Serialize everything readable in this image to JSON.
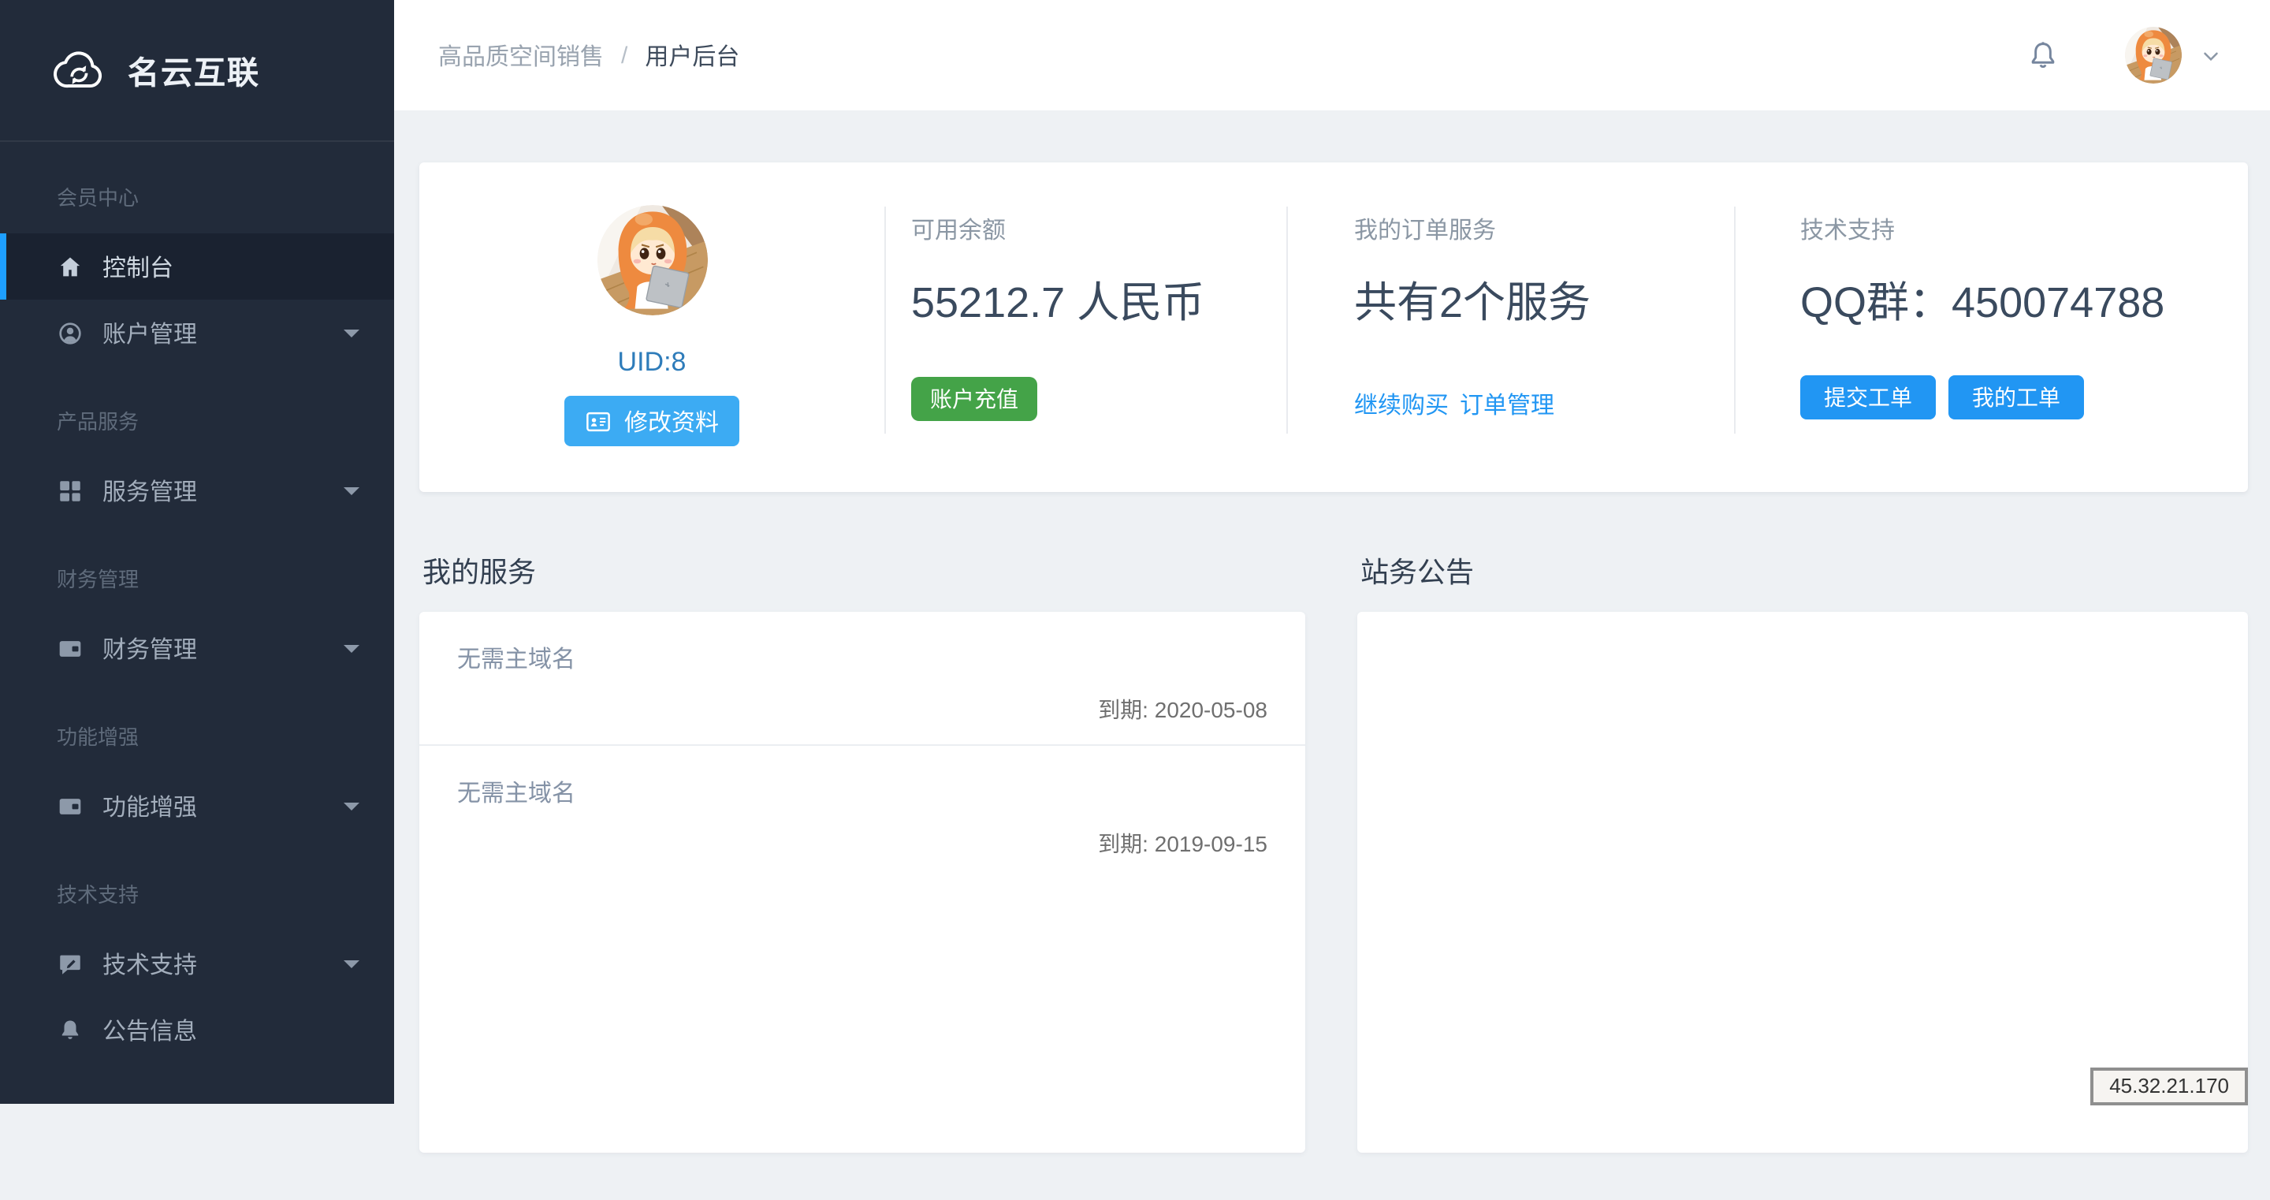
{
  "brand": {
    "title": "名云互联",
    "logo_icon": "cloud-sync-icon"
  },
  "breadcrumb": {
    "section": "高品质空间销售",
    "separator": "/",
    "page": "用户后台"
  },
  "topbar": {
    "icons": [
      "bell-icon",
      "user-avatar",
      "chevron-down-icon"
    ]
  },
  "sidebar": {
    "sections": [
      {
        "label": "会员中心",
        "items": [
          {
            "label": "控制台",
            "icon": "home-icon",
            "active": true,
            "caret": false
          },
          {
            "label": "账户管理",
            "icon": "user-circle-icon",
            "active": false,
            "caret": true
          }
        ]
      },
      {
        "label": "产品服务",
        "items": [
          {
            "label": "服务管理",
            "icon": "grid-icon",
            "active": false,
            "caret": true
          }
        ]
      },
      {
        "label": "财务管理",
        "items": [
          {
            "label": "财务管理",
            "icon": "wallet-icon",
            "active": false,
            "caret": true
          }
        ]
      },
      {
        "label": "功能增强",
        "items": [
          {
            "label": "功能增强",
            "icon": "wallet-icon",
            "active": false,
            "caret": true
          }
        ]
      },
      {
        "label": "技术支持",
        "items": [
          {
            "label": "技术支持",
            "icon": "comment-edit-icon",
            "active": false,
            "caret": true
          },
          {
            "label": "公告信息",
            "icon": "bell-icon",
            "active": false,
            "caret": false
          }
        ]
      }
    ]
  },
  "overview": {
    "account": {
      "uid": "UID:8",
      "edit_button": "修改资料",
      "edit_icon": "id-card-icon"
    },
    "balance": {
      "label": "可用余额",
      "value": "55212.7 人民币",
      "recharge_button": "账户充值"
    },
    "orders": {
      "label": "我的订单服务",
      "value": "共有2个服务",
      "link_continue": "继续购买",
      "link_manage": "订单管理"
    },
    "support": {
      "label": "技术支持",
      "value": "QQ群：450074788",
      "submit_button": "提交工单",
      "my_button": "我的工单"
    }
  },
  "services": {
    "title": "我的服务",
    "rows": [
      {
        "name": "无需主域名",
        "expires": "到期: 2020-05-08"
      },
      {
        "name": "无需主域名",
        "expires": "到期: 2019-09-15"
      }
    ]
  },
  "announcements": {
    "title": "站务公告"
  },
  "status_bubble": {
    "text": "45.32.21.170"
  },
  "colors": {
    "sidebar_bg": "#222B3A",
    "sidebar_active_bg": "#1A2230",
    "accent_blue": "#1E9FFF",
    "link_blue": "#2196F3",
    "edit_button_blue": "#3CABF3",
    "recharge_green": "#44A348",
    "content_bg": "#EEF1F4",
    "big_text": "#3A4A5E",
    "muted_label": "#8B97A4",
    "uid_blue": "#2E7CBA"
  }
}
